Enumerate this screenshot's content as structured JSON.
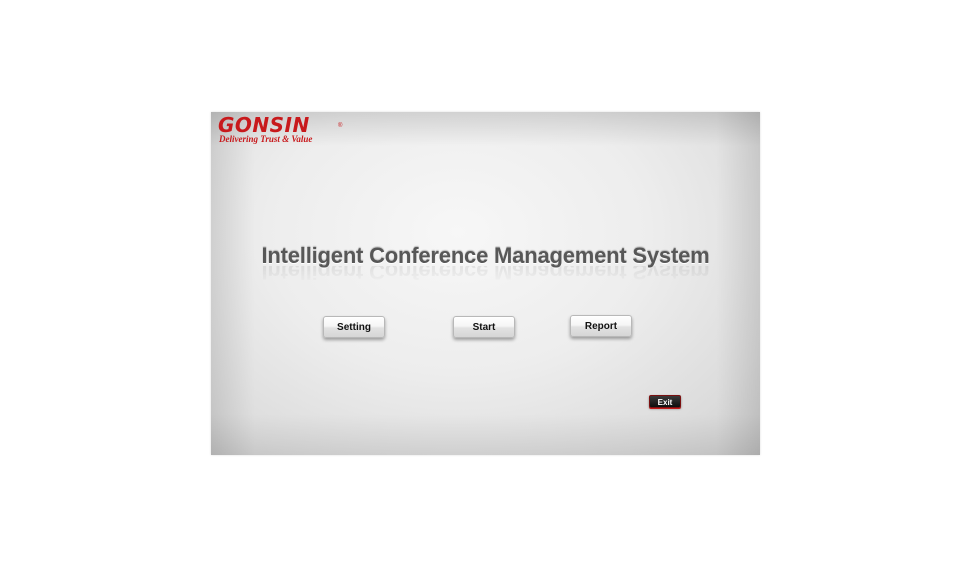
{
  "brand": {
    "name": "GONSIN",
    "registered": "®",
    "tagline": "Delivering Trust & Value",
    "color": "#c8191c"
  },
  "main": {
    "title": "Intelligent Conference Management System"
  },
  "buttons": {
    "setting": "Setting",
    "start": "Start",
    "report": "Report",
    "exit": "Exit"
  }
}
